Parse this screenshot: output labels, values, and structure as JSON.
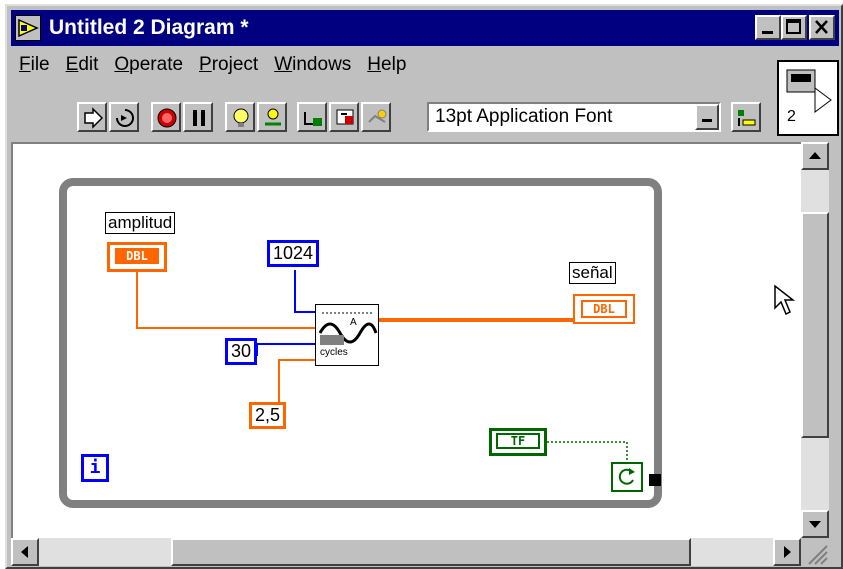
{
  "window": {
    "title": "Untitled 2 Diagram *"
  },
  "menu": {
    "items": [
      {
        "key": "F",
        "rest": "ile"
      },
      {
        "key": "E",
        "rest": "dit"
      },
      {
        "key": "O",
        "rest": "perate"
      },
      {
        "key": "P",
        "rest": "roject"
      },
      {
        "key": "W",
        "rest": "indows"
      },
      {
        "key": "H",
        "rest": "elp"
      }
    ]
  },
  "toolbar": {
    "font_value": "13pt Application Font",
    "icons": [
      "run-icon",
      "run-continuously-icon",
      "abort-icon",
      "pause-icon",
      "highlight-execution-icon",
      "step-into-icon",
      "step-over-icon",
      "step-out-icon"
    ]
  },
  "connector_pane": {
    "number": "2"
  },
  "diagram": {
    "labels": {
      "amplitud": "amplitud",
      "senal": "señal"
    },
    "terminals": {
      "amplitud_type": "DBL",
      "senal_type": "DBL",
      "boolean_type": "TF",
      "iteration": "i"
    },
    "constants": {
      "samples": "1024",
      "cycles": "30",
      "offset": "2,5"
    },
    "subvi": {
      "top_label": "A",
      "cycles_label": "cycles"
    }
  },
  "colors": {
    "orange_wire": "#ff6600",
    "blue_wire": "#0000ff",
    "green_wire": "#006600",
    "loop_border": "#808080",
    "titlebar": "#000080"
  }
}
